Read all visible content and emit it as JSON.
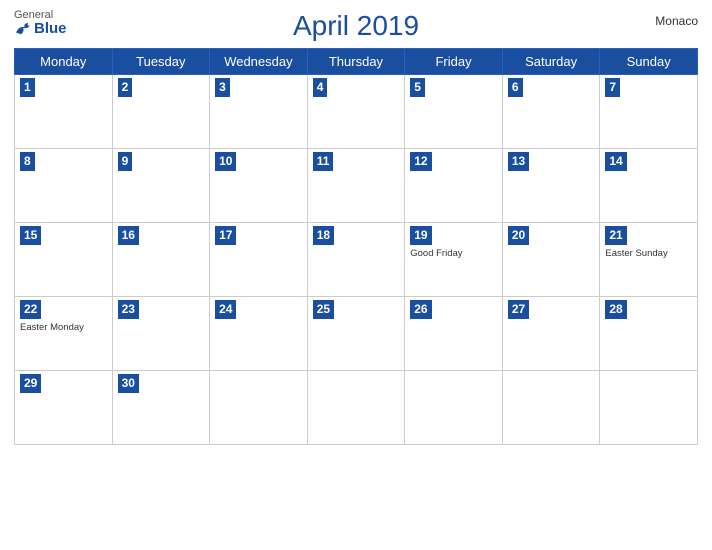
{
  "header": {
    "title": "April 2019",
    "country": "Monaco",
    "logo_general": "General",
    "logo_blue": "Blue"
  },
  "weekdays": [
    "Monday",
    "Tuesday",
    "Wednesday",
    "Thursday",
    "Friday",
    "Saturday",
    "Sunday"
  ],
  "weeks": [
    [
      {
        "day": 1,
        "event": ""
      },
      {
        "day": 2,
        "event": ""
      },
      {
        "day": 3,
        "event": ""
      },
      {
        "day": 4,
        "event": ""
      },
      {
        "day": 5,
        "event": ""
      },
      {
        "day": 6,
        "event": ""
      },
      {
        "day": 7,
        "event": ""
      }
    ],
    [
      {
        "day": 8,
        "event": ""
      },
      {
        "day": 9,
        "event": ""
      },
      {
        "day": 10,
        "event": ""
      },
      {
        "day": 11,
        "event": ""
      },
      {
        "day": 12,
        "event": ""
      },
      {
        "day": 13,
        "event": ""
      },
      {
        "day": 14,
        "event": ""
      }
    ],
    [
      {
        "day": 15,
        "event": ""
      },
      {
        "day": 16,
        "event": ""
      },
      {
        "day": 17,
        "event": ""
      },
      {
        "day": 18,
        "event": ""
      },
      {
        "day": 19,
        "event": "Good Friday"
      },
      {
        "day": 20,
        "event": ""
      },
      {
        "day": 21,
        "event": "Easter Sunday"
      }
    ],
    [
      {
        "day": 22,
        "event": "Easter Monday"
      },
      {
        "day": 23,
        "event": ""
      },
      {
        "day": 24,
        "event": ""
      },
      {
        "day": 25,
        "event": ""
      },
      {
        "day": 26,
        "event": ""
      },
      {
        "day": 27,
        "event": ""
      },
      {
        "day": 28,
        "event": ""
      }
    ],
    [
      {
        "day": 29,
        "event": ""
      },
      {
        "day": 30,
        "event": ""
      },
      {
        "day": null,
        "event": ""
      },
      {
        "day": null,
        "event": ""
      },
      {
        "day": null,
        "event": ""
      },
      {
        "day": null,
        "event": ""
      },
      {
        "day": null,
        "event": ""
      }
    ]
  ]
}
